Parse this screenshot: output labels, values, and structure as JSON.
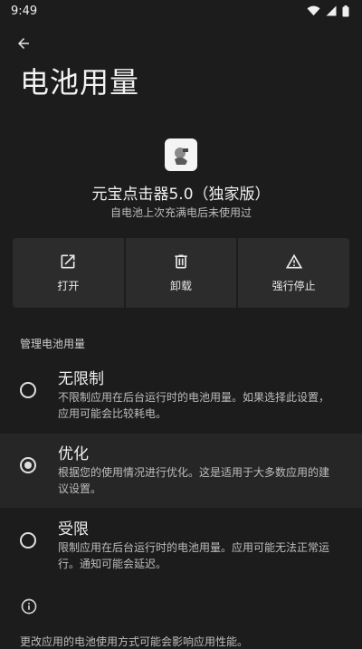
{
  "status_bar": {
    "time": "9:49"
  },
  "header": {
    "title": "电池用量"
  },
  "app": {
    "name": "元宝点击器5.0（独家版）",
    "subtitle": "自电池上次充满电后未使用过"
  },
  "actions": [
    {
      "label": "打开",
      "icon": "open-external-icon"
    },
    {
      "label": "卸载",
      "icon": "trash-icon"
    },
    {
      "label": "强行停止",
      "icon": "warning-icon"
    }
  ],
  "section": {
    "title": "管理电池用量"
  },
  "options": [
    {
      "title": "无限制",
      "desc": "不限制应用在后台运行时的电池用量。如果选择此设置，应用可能会比较耗电。",
      "selected": false
    },
    {
      "title": "优化",
      "desc": "根据您的使用情况进行优化。这是适用于大多数应用的建议设置。",
      "selected": true
    },
    {
      "title": "受限",
      "desc": "限制应用在后台运行时的电池用量。应用可能无法正常运行。通知可能会延迟。",
      "selected": false
    }
  ],
  "footer": {
    "text": "更改应用的电池使用方式可能会影响应用性能。"
  }
}
